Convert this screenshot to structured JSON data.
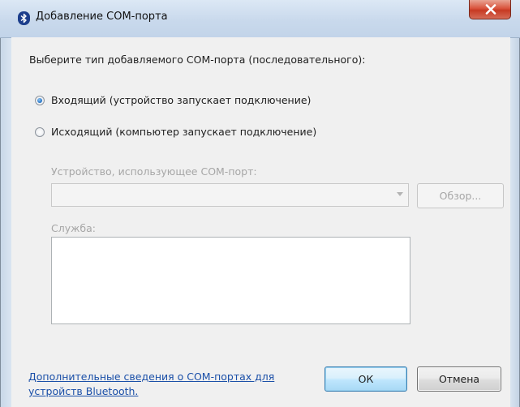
{
  "window": {
    "title": "Добавление COM-порта"
  },
  "dialog": {
    "prompt": "Выберите тип добавляемого COM-порта (последовательного):",
    "port_type": {
      "selected": "incoming",
      "incoming_label": "Входящий (устройство запускает подключение)",
      "outgoing_label": "Исходящий (компьютер запускает подключение)"
    },
    "device": {
      "label": "Устройство, использующее COM-порт:",
      "value": "",
      "browse_label": "Обзор..."
    },
    "service": {
      "label": "Служба:",
      "items": []
    },
    "footer": {
      "help_link": "Дополнительные сведения о COM-портах для устройств Bluetooth.",
      "ok_label": "ОК",
      "cancel_label": "Отмена"
    }
  },
  "icons": {
    "title_icon": "bluetooth-icon",
    "close": "close-icon",
    "dropdown": "chevron-down-icon"
  },
  "colors": {
    "link": "#1a4fa8",
    "close_button": "#c73a23",
    "radio_selected": "#1f6fc2"
  }
}
